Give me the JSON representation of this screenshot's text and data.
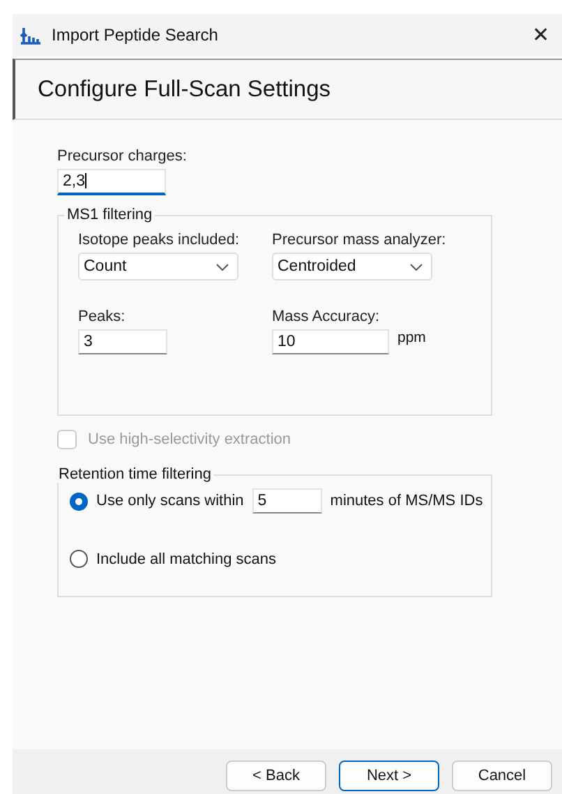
{
  "window": {
    "title": "Import Peptide Search",
    "close": "✕"
  },
  "header": {
    "title": "Configure Full-Scan Settings"
  },
  "precursor_charges": {
    "label": "Precursor charges:",
    "value": "2,3"
  },
  "ms1_filtering": {
    "title": "MS1 filtering",
    "isotope_peaks": {
      "label": "Isotope peaks included:",
      "value": "Count"
    },
    "mass_analyzer": {
      "label": "Precursor mass analyzer:",
      "value": "Centroided"
    },
    "peaks": {
      "label": "Peaks:",
      "value": "3"
    },
    "mass_accuracy": {
      "label": "Mass Accuracy:",
      "value": "10",
      "unit": "ppm"
    }
  },
  "high_selectivity": {
    "label": "Use high-selectivity extraction",
    "checked": false,
    "disabled": true
  },
  "retention_time_filtering": {
    "title": "Retention time filtering",
    "options": [
      {
        "label": "Use only scans within",
        "value": "5",
        "suffix": "minutes of MS/MS IDs",
        "selected": true
      },
      {
        "label": "Include all matching scans",
        "selected": false
      }
    ]
  },
  "buttons": [
    {
      "label": "< Back",
      "default": false
    },
    {
      "label": "Next >",
      "default": true
    },
    {
      "label": "Cancel",
      "default": false
    }
  ]
}
